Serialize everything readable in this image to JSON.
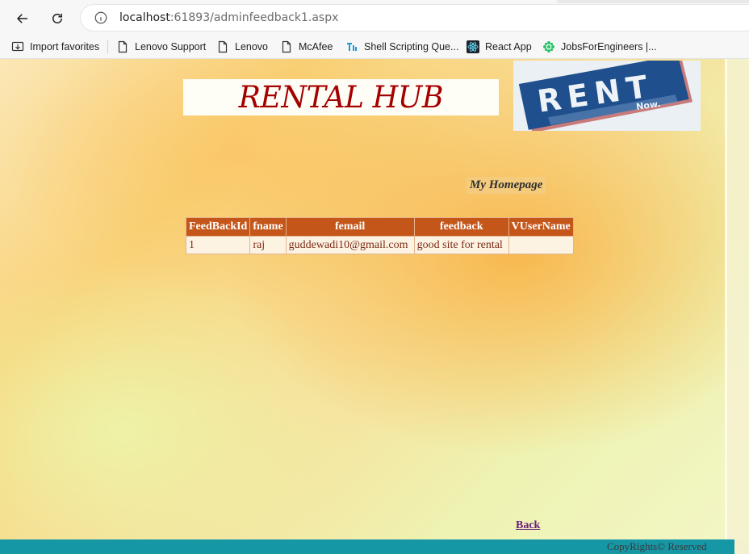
{
  "browser": {
    "url_host": "localhost",
    "url_rest": ":61893/adminfeedback1.aspx",
    "bookmarks": [
      {
        "label": "Import favorites",
        "icon": "import-icon"
      },
      {
        "label": "Lenovo Support",
        "icon": "page-icon"
      },
      {
        "label": "Lenovo",
        "icon": "page-icon"
      },
      {
        "label": "McAfee",
        "icon": "page-icon"
      },
      {
        "label": "Shell Scripting Que...",
        "icon": "tutorial-icon"
      },
      {
        "label": "React App",
        "icon": "react-icon"
      },
      {
        "label": "JobsForEngineers |...",
        "icon": "leaf-icon"
      }
    ]
  },
  "page": {
    "logo_text": "RENTAL HUB",
    "badge_main": "RENT",
    "badge_sub": "Now.",
    "homepage_link": "My Homepage",
    "table": {
      "headers": [
        "FeedBackId",
        "fname",
        "femail",
        "feedback",
        "VUserName"
      ],
      "rows": [
        [
          "1",
          "raj",
          "guddewadi10@gmail.com",
          "good site for rental",
          ""
        ]
      ]
    },
    "back_link": "Back",
    "footer_text": "CopyRights© Reserved"
  },
  "colors": {
    "header_bg": "#c4561a",
    "logo_red": "#a50000",
    "footer_bar": "#1697a6"
  }
}
